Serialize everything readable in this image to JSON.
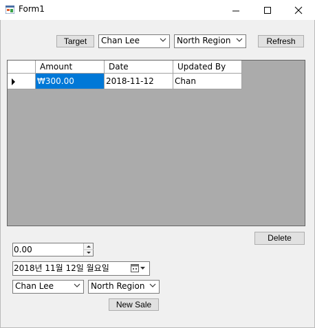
{
  "window": {
    "title": "Form1"
  },
  "toolbar": {
    "target_label": "Target",
    "person_select": "Chan Lee",
    "region_select": "North Region",
    "refresh_label": "Refresh"
  },
  "grid": {
    "columns": [
      "Amount",
      "Date",
      "Updated By"
    ],
    "rows": [
      {
        "amount": "₩300.00",
        "date": "2018-11-12",
        "updated_by": "Chan"
      }
    ]
  },
  "actions": {
    "delete_label": "Delete",
    "new_sale_label": "New Sale"
  },
  "form": {
    "amount_value": "0.00",
    "date_value": "2018년 11월 12일 월요일",
    "person_select": "Chan Lee",
    "region_select": "North Region"
  },
  "colors": {
    "selection": "#0078d7",
    "grid_background": "#ababab"
  }
}
